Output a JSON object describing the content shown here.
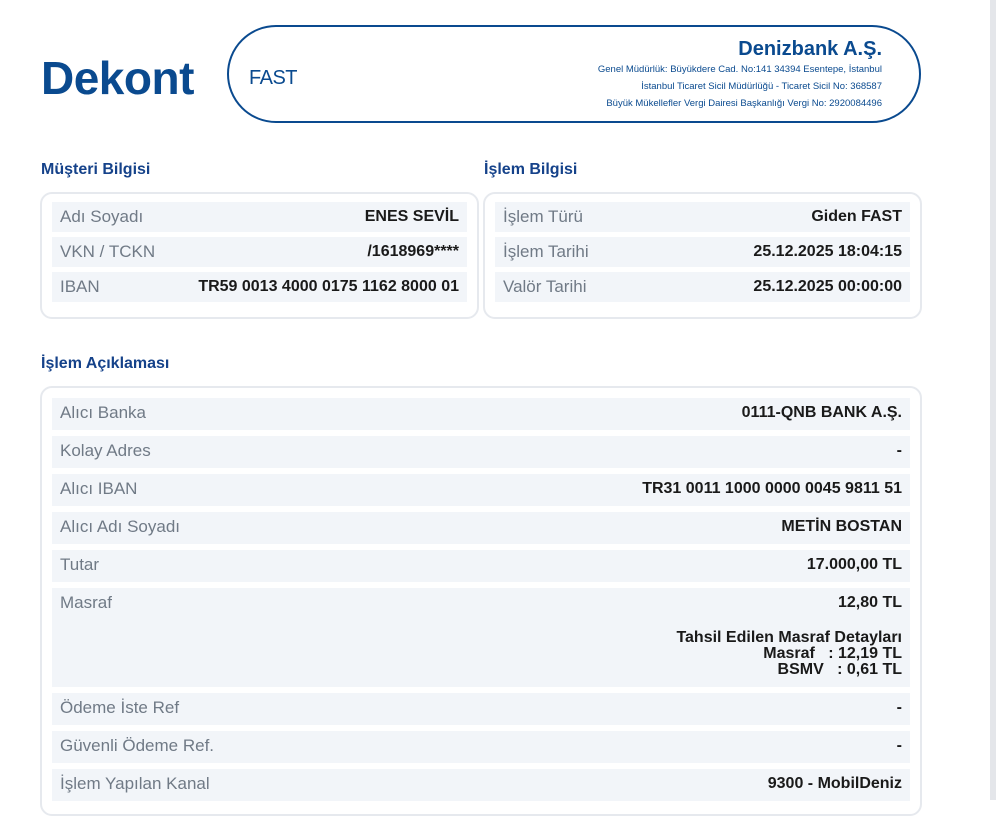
{
  "header": {
    "title": "Dekont",
    "type": "FAST",
    "bank_name": "Denizbank A.Ş.",
    "bank_lines": [
      "Genel Müdürlük: Büyükdere Cad. No:141 34394 Esentepe, İstanbul",
      "İstanbul Ticaret Sicil Müdürlüğü - Ticaret Sicil No: 368587",
      "Büyük Mükellefler Vergi Dairesi Başkanlığı Vergi No: 2920084496"
    ]
  },
  "customer": {
    "title": "Müşteri Bilgisi",
    "rows": [
      {
        "label": "Adı Soyadı",
        "value": "ENES SEVİL"
      },
      {
        "label": "VKN / TCKN",
        "value": "/1618969****"
      },
      {
        "label": "IBAN",
        "value": "TR59 0013 4000 0175 1162 8000 01"
      }
    ]
  },
  "transaction": {
    "title": "İşlem Bilgisi",
    "rows": [
      {
        "label": "İşlem Türü",
        "value": "Giden FAST"
      },
      {
        "label": "İşlem Tarihi",
        "value": "25.12.2025 18:04:15"
      },
      {
        "label": "Valör Tarihi",
        "value": "25.12.2025 00:00:00"
      }
    ]
  },
  "description": {
    "title": "İşlem Açıklaması",
    "rows": [
      {
        "label": "Alıcı Banka",
        "value": "0111-QNB BANK A.Ş."
      },
      {
        "label": "Kolay Adres",
        "value": "-"
      },
      {
        "label": "Alıcı IBAN",
        "value": "TR31 0011 1000 0000 0045 9811 51"
      },
      {
        "label": "Alıcı Adı Soyadı",
        "value": "METİN BOSTAN"
      },
      {
        "label": "Tutar",
        "value": "17.000,00 TL"
      },
      {
        "label": "Masraf",
        "value": "12,80 TL"
      },
      {
        "label": "Ödeme İste Ref",
        "value": "-"
      },
      {
        "label": "Güvenli Ödeme Ref.",
        "value": "-"
      },
      {
        "label": "İşlem Yapılan Kanal",
        "value": "9300 - MobilDeniz"
      }
    ],
    "fee_details": {
      "title": "Tahsil Edilen Masraf Detayları",
      "masraf": "Masraf   : 12,19 TL",
      "bsmv": "BSMV   : 0,61 TL"
    }
  }
}
